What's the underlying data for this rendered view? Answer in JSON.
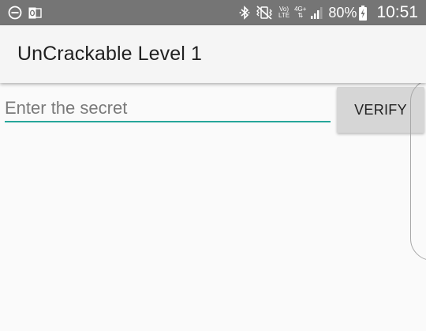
{
  "status_bar": {
    "left_icons": [
      "do-not-disturb-icon",
      "outlook-icon"
    ],
    "bluetooth_icon": "bluetooth-icon",
    "vibrate_icon": "vibrate-icon",
    "volte_line1": "Vo)",
    "volte_line2": "LTE",
    "network_type": "4G+",
    "signal_icon": "signal-icon",
    "battery_percent": "80%",
    "battery_icon": "battery-charging-icon",
    "time": "10:51"
  },
  "app_bar": {
    "title": "UnCrackable Level 1"
  },
  "main": {
    "secret_input": {
      "value": "",
      "placeholder": "Enter the secret"
    },
    "verify_label": "VERIFY"
  },
  "colors": {
    "status_bar": "#757575",
    "app_bar": "#f5f5f5",
    "accent": "#26a69a",
    "button": "#d6d6d6",
    "background": "#fafafa"
  }
}
